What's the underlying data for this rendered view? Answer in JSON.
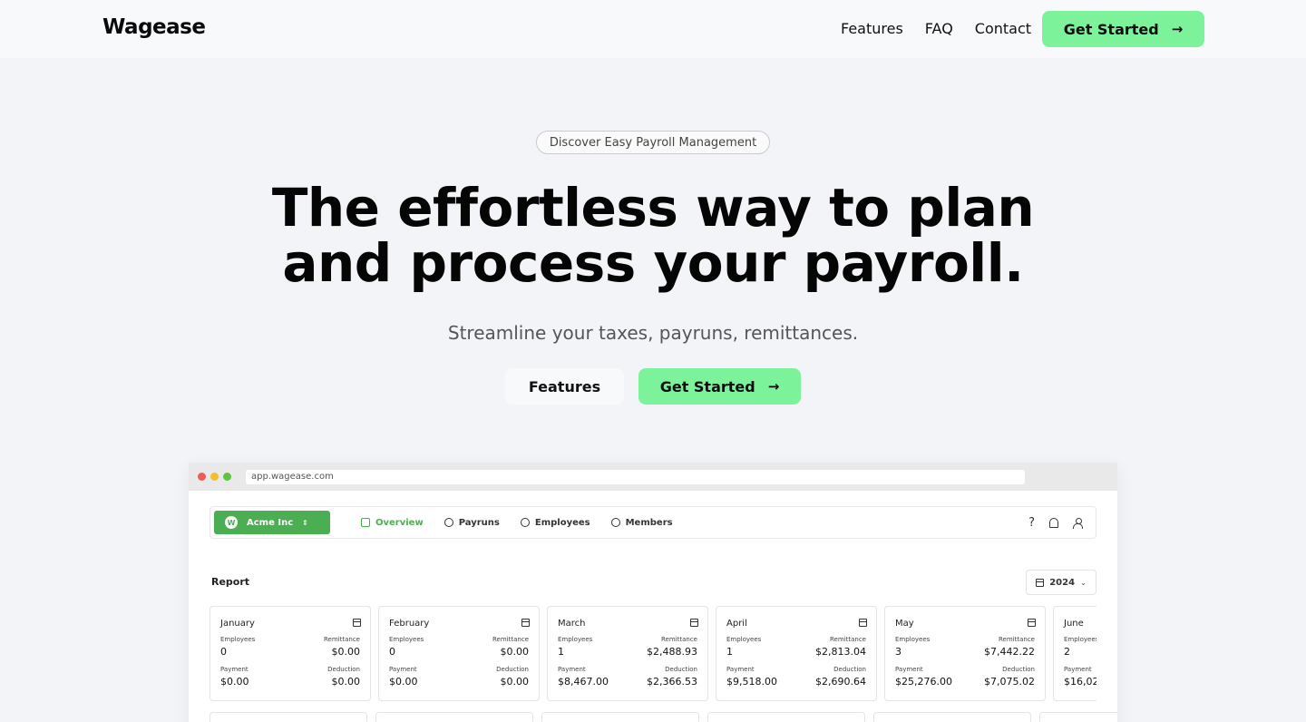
{
  "nav": {
    "logo": "Wagease",
    "links": [
      "Features",
      "FAQ",
      "Contact"
    ],
    "cta": "Get Started"
  },
  "hero": {
    "badge": "Discover Easy Payroll Management",
    "headline_line1": "The effortless way to plan",
    "headline_line2": "and process your payroll.",
    "subtitle": "Streamline your taxes, payruns, remittances.",
    "secondary_button": "Features",
    "primary_button": "Get Started"
  },
  "app": {
    "url": "app.wagease.com",
    "org_initial": "W",
    "org_name": "Acme Inc",
    "tabs": [
      "Overview",
      "Payruns",
      "Employees",
      "Members"
    ],
    "help": "?",
    "report_title": "Report",
    "year": "2024",
    "labels": {
      "employees": "Employees",
      "remittance": "Remittance",
      "payment": "Payment",
      "deduction": "Deduction"
    },
    "months": [
      {
        "name": "January",
        "employees": "0",
        "remittance": "$0.00",
        "payment": "$0.00",
        "deduction": "$0.00"
      },
      {
        "name": "February",
        "employees": "0",
        "remittance": "$0.00",
        "payment": "$0.00",
        "deduction": "$0.00"
      },
      {
        "name": "March",
        "employees": "1",
        "remittance": "$2,488.93",
        "payment": "$8,467.00",
        "deduction": "$2,366.53"
      },
      {
        "name": "April",
        "employees": "1",
        "remittance": "$2,813.04",
        "payment": "$9,518.00",
        "deduction": "$2,690.64"
      },
      {
        "name": "May",
        "employees": "3",
        "remittance": "$7,442.22",
        "payment": "$25,276.00",
        "deduction": "$7,075.02"
      },
      {
        "name": "June",
        "employees": "2",
        "remittance": "",
        "payment": "$16,02",
        "deduction": ""
      }
    ]
  },
  "colors": {
    "accent": "#7cf29a",
    "app_green": "#4cae52",
    "background": "#f3f4f7"
  }
}
